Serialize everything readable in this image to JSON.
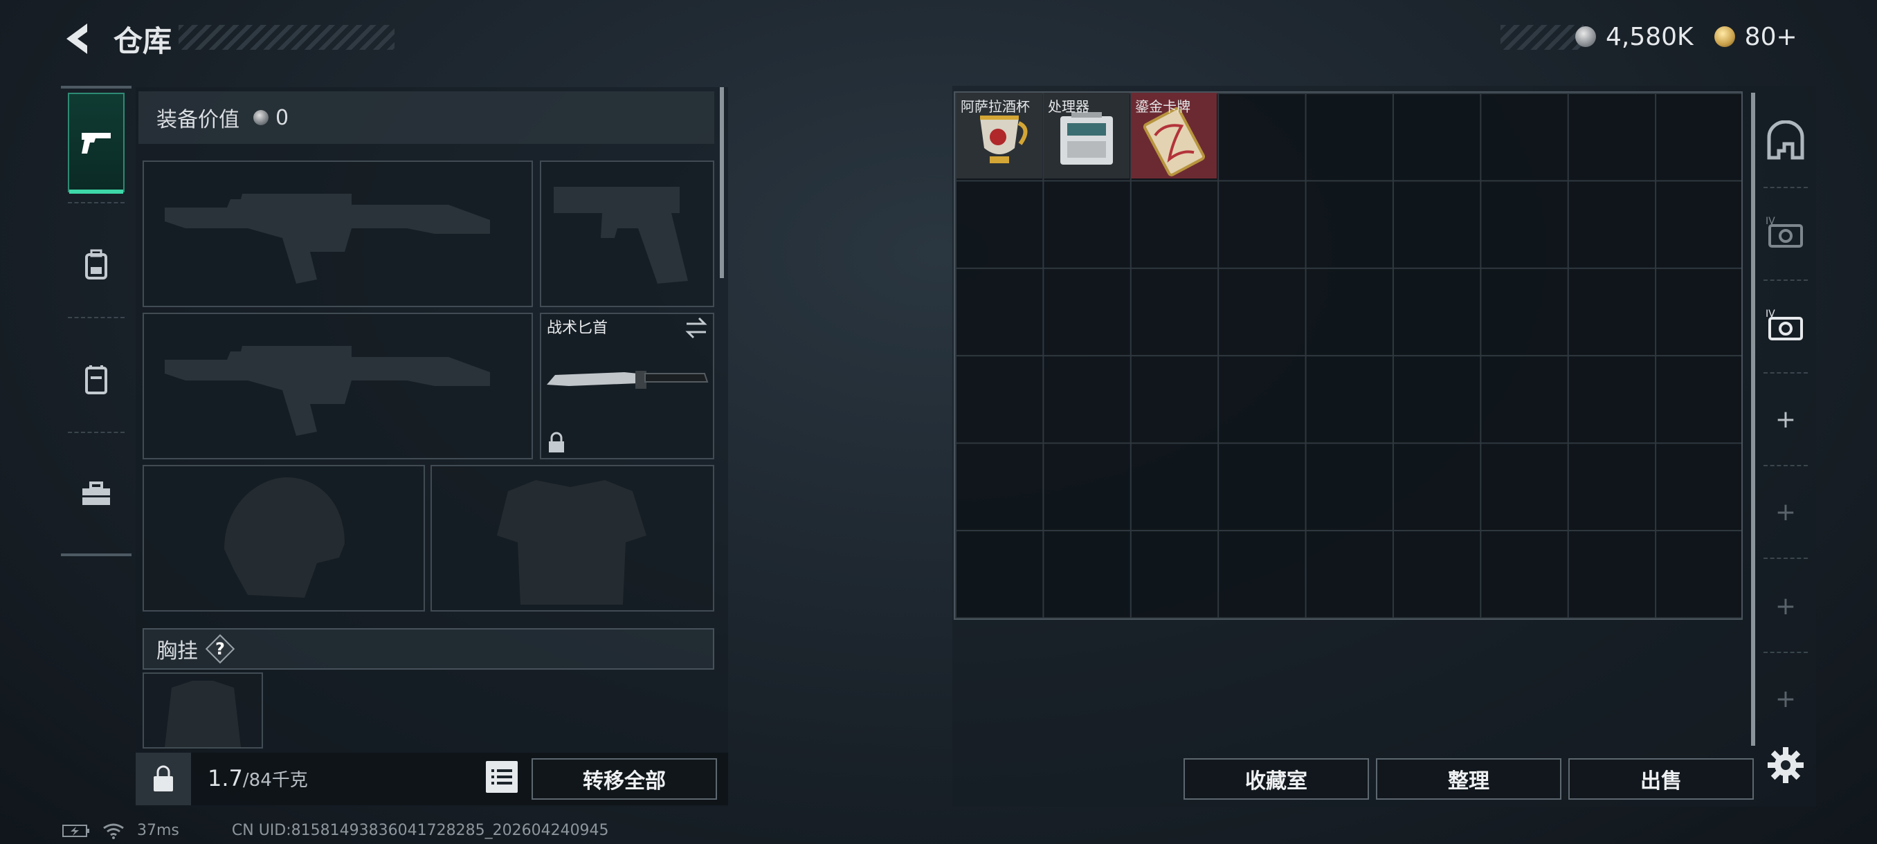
{
  "header": {
    "title": "仓库"
  },
  "currency": {
    "silver": "4,580K",
    "gold": "80+"
  },
  "equipment": {
    "value_label": "装备价值",
    "value": "0",
    "knife_slot": {
      "label": "战术匕首"
    },
    "chest_rig": {
      "label": "胸挂",
      "help": "?"
    }
  },
  "footer_left": {
    "weight_current": "1.7",
    "weight_max": "/84千克",
    "transfer_all": "转移全部"
  },
  "stash": {
    "items": [
      {
        "name": "阿萨拉酒杯"
      },
      {
        "name": "处理器"
      },
      {
        "name": "鎏金卡牌"
      }
    ],
    "actions": {
      "collection": "收藏室",
      "sort": "整理",
      "sell": "出售"
    }
  },
  "right_rail": {
    "add_labels": [
      "+",
      "+",
      "+",
      "+"
    ]
  },
  "status_bar": {
    "ping": "37ms",
    "uid": "CN UID:81581493836041728285_202604240945"
  },
  "colors": {
    "accent_green": "#3ed8a8",
    "card_red": "#6b2a32",
    "panel": "#161e24"
  },
  "icons": [
    "back-arrow-icon",
    "silver-coin-icon",
    "gold-coin-icon",
    "pistol-icon",
    "backpack-icon",
    "vest-icon",
    "toolbox-icon",
    "lock-icon",
    "list-icon",
    "swap-icon",
    "safe-icon",
    "case-icon",
    "gear-icon",
    "battery-icon",
    "wifi-icon"
  ]
}
